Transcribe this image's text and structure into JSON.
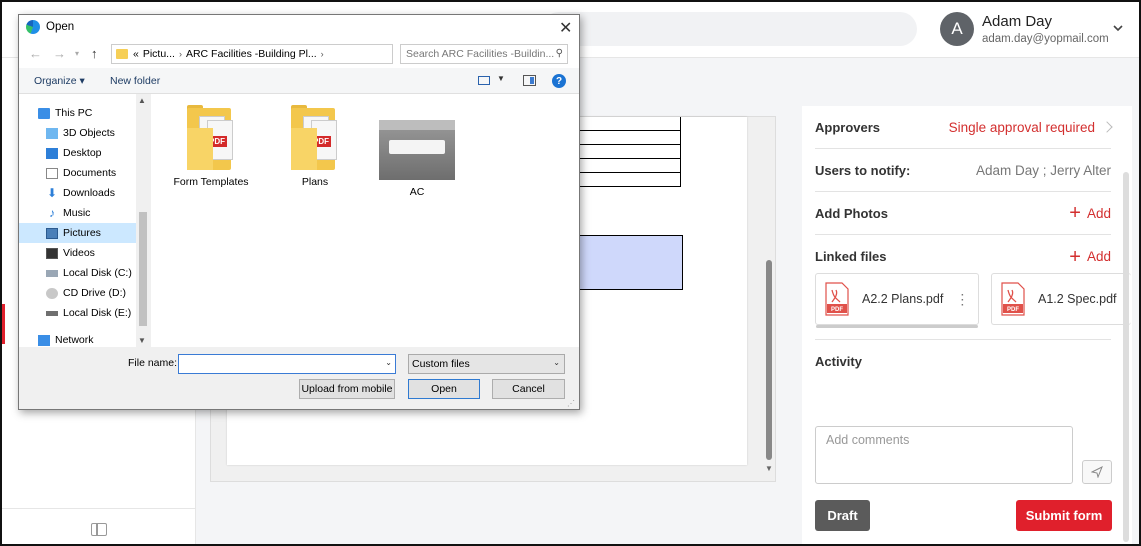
{
  "app": {
    "user": {
      "initial": "A",
      "name": "Adam Day",
      "email": "adam.day@yopmail.com"
    }
  },
  "panel": {
    "approvers_label": "Approvers",
    "approvers_value": "Single approval required",
    "notify_label": "Users to notify:",
    "notify_value": "Adam Day ;  Jerry Alter",
    "photos_label": "Add Photos",
    "photos_add": "Add",
    "linked_label": "Linked files",
    "linked_add": "Add",
    "files": [
      {
        "name": "A2.2 Plans.pdf"
      },
      {
        "name": "A1.2 Spec.pdf"
      }
    ],
    "activity_label": "Activity",
    "comment_placeholder": "Add comments",
    "draft_label": "Draft",
    "submit_label": "Submit form"
  },
  "colors": {
    "accent": "#e0202c",
    "link_red": "#d32f2f",
    "draft": "#5b5b5b"
  },
  "dialog": {
    "title": "Open",
    "path": [
      "«",
      "Pictu...",
      "ARC Facilities -Building Pl..."
    ],
    "search_placeholder": "Search ARC Facilities -Buildin...",
    "organize": "Organize",
    "new_folder": "New folder",
    "tree": [
      {
        "label": "This PC",
        "icon": "pc-icon"
      },
      {
        "label": "3D Objects",
        "icon": "cube-icon"
      },
      {
        "label": "Desktop",
        "icon": "desktop-icon"
      },
      {
        "label": "Documents",
        "icon": "documents-icon"
      },
      {
        "label": "Downloads",
        "icon": "download-icon"
      },
      {
        "label": "Music",
        "icon": "music-icon"
      },
      {
        "label": "Pictures",
        "icon": "pictures-icon"
      },
      {
        "label": "Videos",
        "icon": "videos-icon"
      },
      {
        "label": "Local Disk (C:)",
        "icon": "disk-icon"
      },
      {
        "label": "CD Drive (D:)",
        "icon": "cd-icon"
      },
      {
        "label": "Local Disk (E:)",
        "icon": "disk-icon"
      },
      {
        "label": "Network",
        "icon": "network-icon"
      }
    ],
    "files": [
      {
        "name": "Form Templates",
        "type": "folder"
      },
      {
        "name": "Plans",
        "type": "folder"
      },
      {
        "name": "AC",
        "type": "image"
      }
    ],
    "filename_label": "File name:",
    "filename_value": "",
    "filter": "Custom files",
    "upload_label": "Upload from mobile",
    "open_label": "Open",
    "cancel_label": "Cancel"
  }
}
